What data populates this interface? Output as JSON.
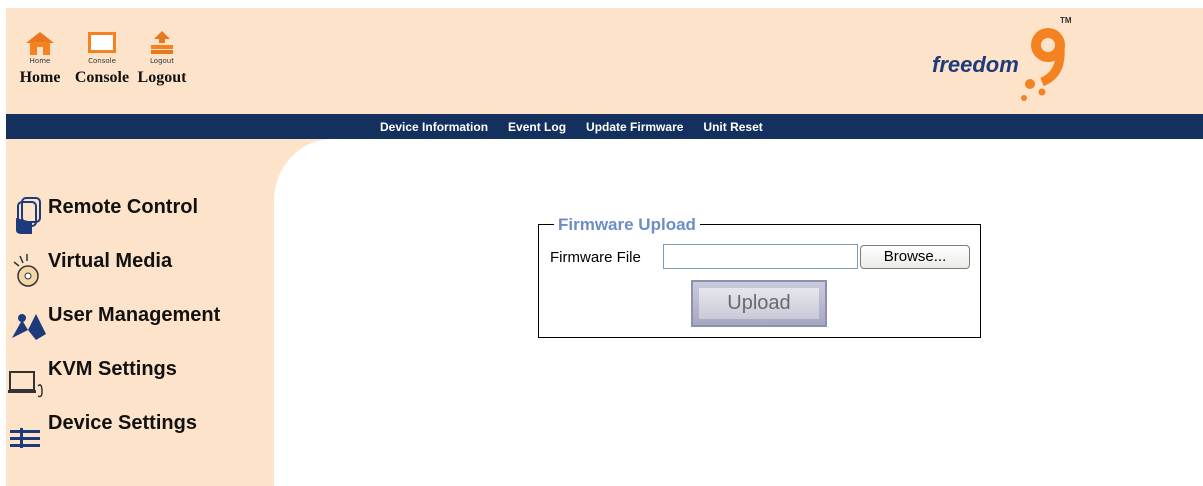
{
  "top_icons": [
    {
      "small": "Home",
      "label": "Home",
      "icon": "home-icon"
    },
    {
      "small": "Console",
      "label": "Console",
      "icon": "console-icon"
    },
    {
      "small": "Logout",
      "label": "Logout",
      "icon": "logout-icon"
    }
  ],
  "logo": {
    "text": "freedom",
    "mark": "9",
    "tm": "TM"
  },
  "nav": [
    "Device Information",
    "Event Log",
    "Update Firmware",
    "Unit Reset"
  ],
  "sidebar": [
    {
      "label": "Remote Control",
      "icon": "remote-control-icon"
    },
    {
      "label": "Virtual Media",
      "icon": "virtual-media-icon"
    },
    {
      "label": "User Management",
      "icon": "user-management-icon"
    },
    {
      "label": "KVM Settings",
      "icon": "kvm-settings-icon"
    },
    {
      "label": "Device Settings",
      "icon": "device-settings-icon"
    }
  ],
  "firmware": {
    "legend": "Firmware Upload",
    "file_label": "Firmware File",
    "file_value": "",
    "browse_label": "Browse...",
    "upload_label": "Upload"
  },
  "colors": {
    "header_bg": "#fde3c9",
    "nav_bg": "#14305f",
    "accent": "#f58220",
    "legend": "#6a8ec6"
  }
}
